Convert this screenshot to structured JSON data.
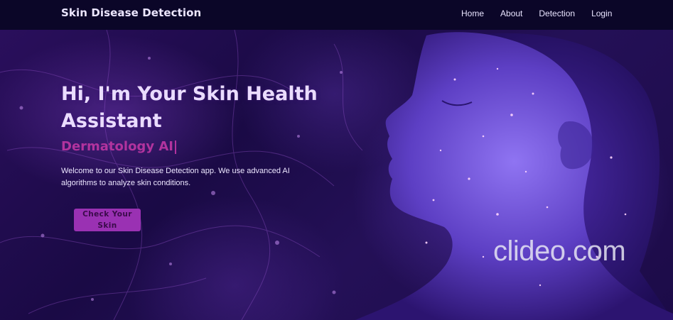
{
  "navbar": {
    "brand": "Skin Disease Detection",
    "links": [
      {
        "label": "Home"
      },
      {
        "label": "About"
      },
      {
        "label": "Detection"
      },
      {
        "label": "Login"
      }
    ]
  },
  "hero": {
    "title": "Hi, I'm Your Skin Health Assistant",
    "subtitle": "Dermatology AI",
    "description": "Welcome to our Skin Disease Detection app. We use advanced AI algorithms to analyze skin conditions.",
    "cta_label": "Check Your Skin",
    "image_icon": "glowing-face-profile-illustration"
  },
  "watermark": {
    "text": "clideo.com"
  },
  "colors": {
    "navbar_bg": "#0b0628",
    "hero_accent": "#b2339e",
    "button_bg": "#9a31b3",
    "text_light": "#ece6ff"
  }
}
